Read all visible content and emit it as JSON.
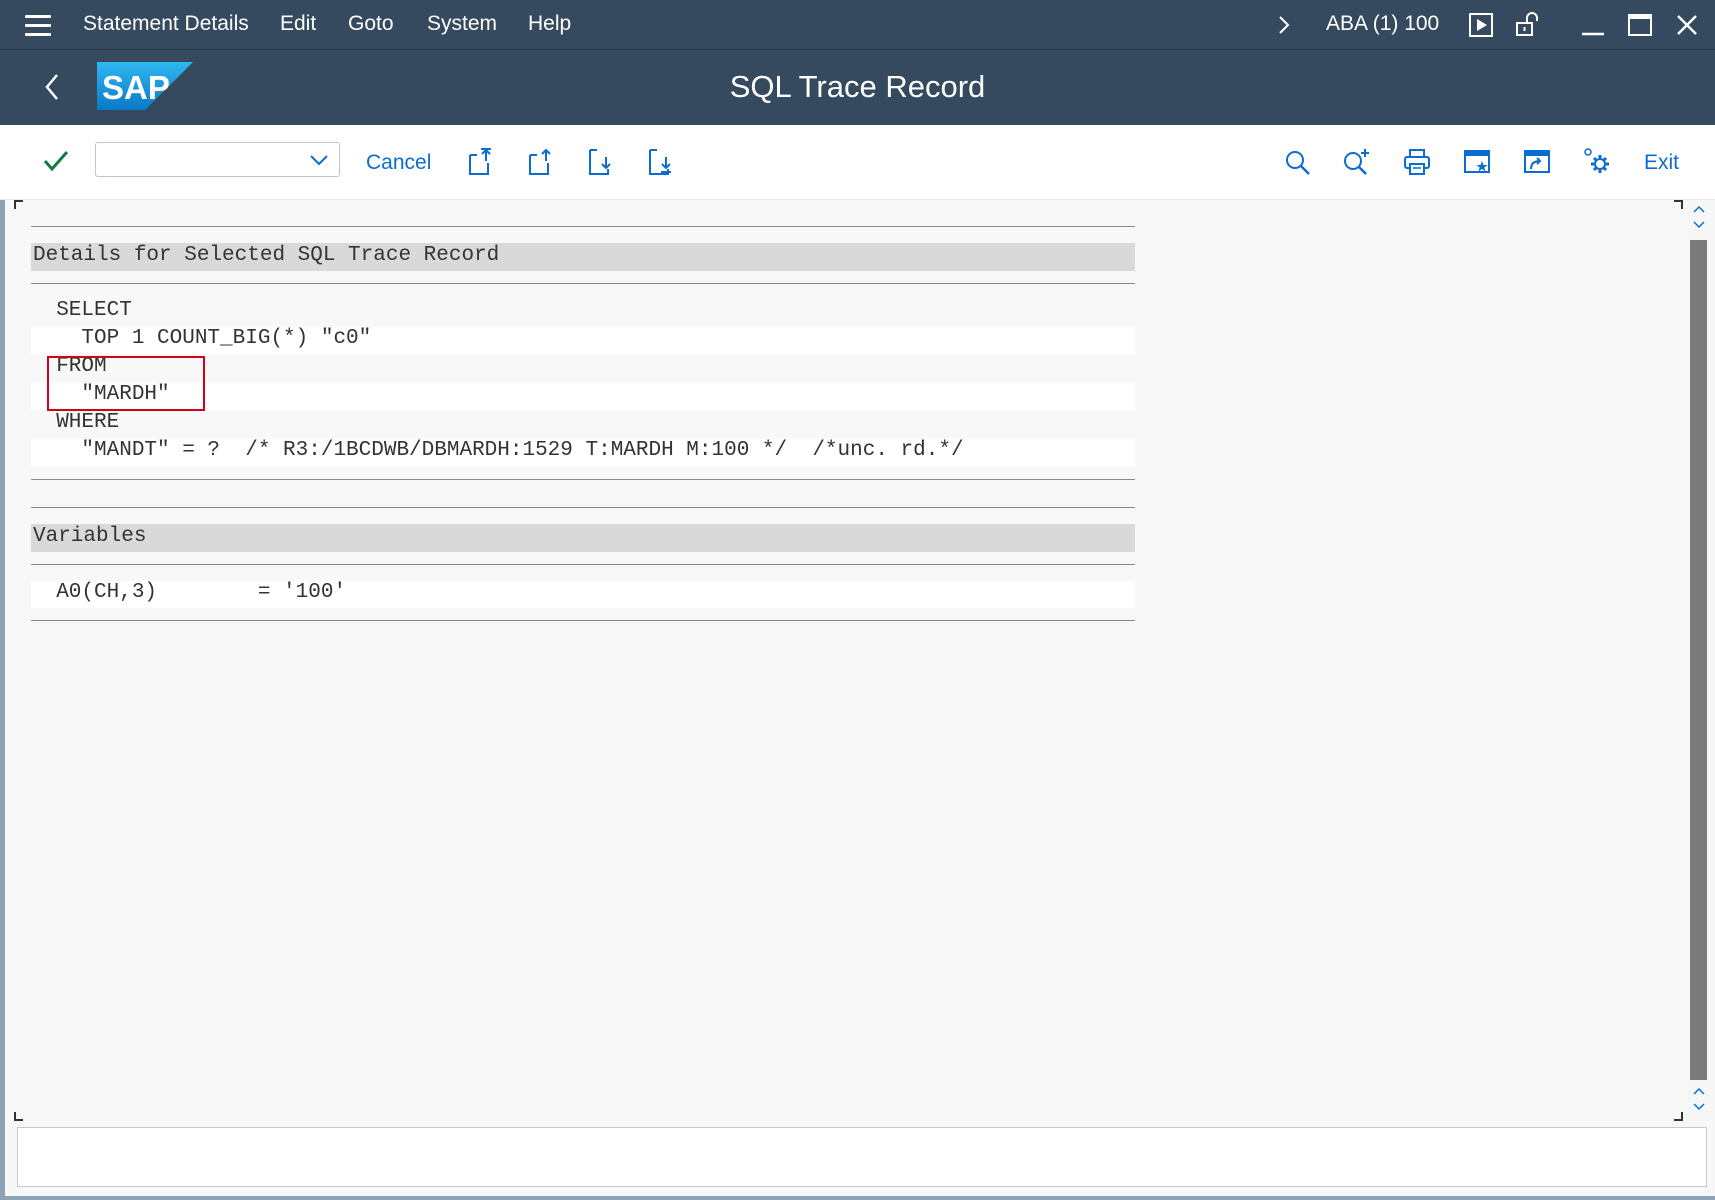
{
  "menubar": {
    "items": [
      {
        "label": "Statement Details"
      },
      {
        "label": "Edit"
      },
      {
        "label": "Goto"
      },
      {
        "label": "System"
      },
      {
        "label": "Help"
      }
    ],
    "system_info": "ABA (1) 100"
  },
  "titlebar": {
    "title": "SQL Trace Record",
    "logo_text": "SAP"
  },
  "toolbar": {
    "command_field_value": "",
    "cancel_label": "Cancel",
    "exit_label": "Exit"
  },
  "content": {
    "details_header": "Details for Selected SQL Trace Record",
    "sql_lines": [
      "  SELECT",
      "    TOP 1 COUNT_BIG(*) \"c0\"",
      "  FROM",
      "    \"MARDH\"",
      "  WHERE",
      "    \"MANDT\" = ?  /* R3:/1BCDWB/DBMARDH:1529 T:MARDH M:100 */  /*unc. rd.*/"
    ],
    "variables_header": "Variables",
    "variable_lines": [
      "  A0(CH,3)        = '100'"
    ]
  },
  "colors": {
    "shell": "#354a5f",
    "accent": "#0a6ed1",
    "confirm": "#107e3e",
    "highlight": "#d0021b"
  }
}
